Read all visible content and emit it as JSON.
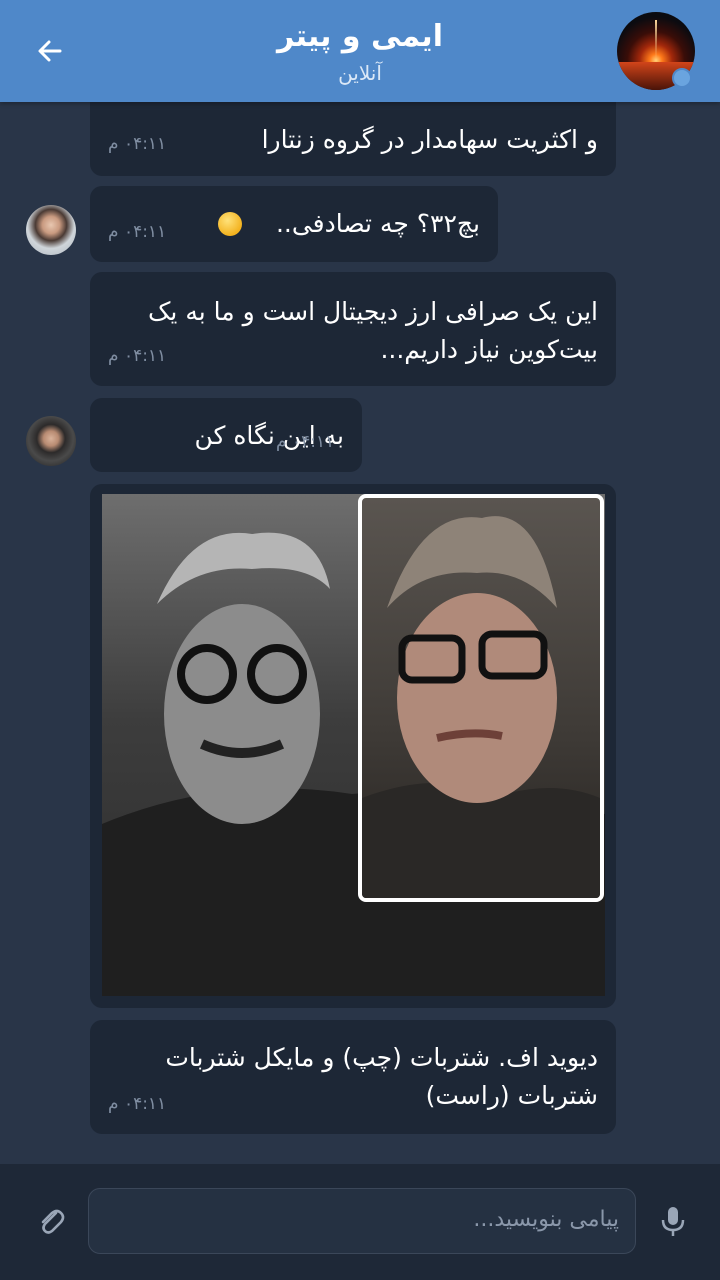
{
  "header": {
    "title": "ایمی و پیتر",
    "status": "آنلاین"
  },
  "messages": [
    {
      "lines": [
        "و اکثریت سهامدار در گروه زنتارا"
      ],
      "time": "۰۴:۱۱ م"
    },
    {
      "text": "بچ۳۲؟ چه تصادفی..",
      "time": "۰۴:۱۱ م"
    },
    {
      "lines": [
        "این یک صرافی ارز دیجیتال است و ما به یک",
        "بیت‌کوین نیاز داریم..."
      ],
      "time": "۰۴:۱۱ م"
    },
    {
      "text": "به این نگاه کن",
      "time": "۰۴:۱۱ م"
    },
    {
      "lines": [
        "دیوید اف. شتربات (چپ) و مایکل شتربات",
        "شتربات (راست)"
      ],
      "time": "۰۴:۱۱ م"
    }
  ],
  "composer": {
    "placeholder": "پیامی بنویسید..."
  },
  "colors": {
    "header": "#4f88c9",
    "background": "#293548",
    "bubble": "#1d2736"
  },
  "icons": [
    "back-arrow-icon",
    "attach-icon",
    "microphone-icon",
    "smiling-face-emoji"
  ]
}
